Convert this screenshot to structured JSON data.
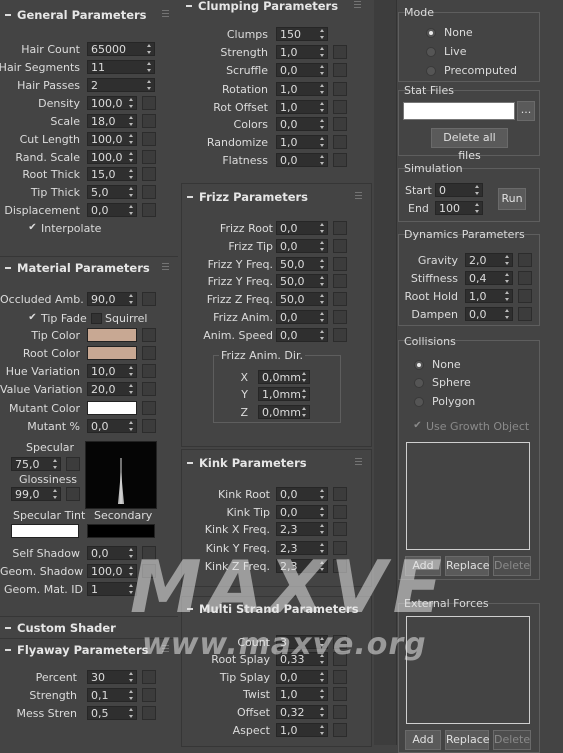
{
  "general": {
    "title": "General Parameters",
    "rows": [
      {
        "label": "Hair Count",
        "value": "65000"
      },
      {
        "label": "Hair Segments",
        "value": "11"
      },
      {
        "label": "Hair Passes",
        "value": "2"
      },
      {
        "label": "Density",
        "value": "100,0"
      },
      {
        "label": "Scale",
        "value": "18,0"
      },
      {
        "label": "Cut Length",
        "value": "100,0"
      },
      {
        "label": "Rand. Scale",
        "value": "100,0"
      },
      {
        "label": "Root Thick",
        "value": "15,0"
      },
      {
        "label": "Tip Thick",
        "value": "5,0"
      },
      {
        "label": "Displacement",
        "value": "0,0"
      }
    ],
    "interpolate": "Interpolate"
  },
  "material": {
    "title": "Material Parameters",
    "occluded_label": "Occluded Amb.",
    "occluded_value": "90,0",
    "tip_fade": "Tip Fade",
    "squirrel": "Squirrel",
    "tip_color_label": "Tip Color",
    "tip_color": "#c8a893",
    "root_color_label": "Root Color",
    "root_color": "#c8a893",
    "hue_label": "Hue Variation",
    "hue_value": "10,0",
    "value_label": "Value Variation",
    "value_value": "20,0",
    "mutant_color_label": "Mutant Color",
    "mutant_color": "#ffffff",
    "mutant_pct_label": "Mutant %",
    "mutant_pct_value": "0,0",
    "specular_label": "Specular",
    "specular_value": "75,0",
    "gloss_label": "Glossiness",
    "gloss_value": "99,0",
    "spec_tint_label": "Specular Tint",
    "spec_tint": "#ffffff",
    "secondary_label": "Secondary",
    "secondary": "#000000",
    "self_shadow_label": "Self Shadow",
    "self_shadow_value": "0,0",
    "geom_shadow_label": "Geom. Shadow",
    "geom_shadow_value": "100,0",
    "geom_mat_label": "Geom. Mat. ID",
    "geom_mat_value": "1"
  },
  "custom_shader": {
    "title": "Custom Shader"
  },
  "flyaway": {
    "title": "Flyaway Parameters",
    "rows": [
      {
        "label": "Percent",
        "value": "30"
      },
      {
        "label": "Strength",
        "value": "0,1"
      },
      {
        "label": "Mess Stren",
        "value": "0,5"
      }
    ]
  },
  "clumping": {
    "title": "Clumping Parameters",
    "rows": [
      {
        "label": "Clumps",
        "value": "150"
      },
      {
        "label": "Strength",
        "value": "1,0"
      },
      {
        "label": "Scruffle",
        "value": "0,0"
      },
      {
        "label": "Rotation",
        "value": "1,0"
      },
      {
        "label": "Rot Offset",
        "value": "1,0"
      },
      {
        "label": "Colors",
        "value": "0,0"
      },
      {
        "label": "Randomize",
        "value": "1,0"
      },
      {
        "label": "Flatness",
        "value": "0,0"
      }
    ]
  },
  "frizz": {
    "title": "Frizz Parameters",
    "rows": [
      {
        "label": "Frizz Root",
        "value": "0,0"
      },
      {
        "label": "Frizz Tip",
        "value": "0,0"
      },
      {
        "label": "Frizz Y Freq.",
        "value": "50,0"
      },
      {
        "label": "Frizz Y Freq.",
        "value": "50,0"
      },
      {
        "label": "Frizz Z Freq.",
        "value": "50,0"
      },
      {
        "label": "Frizz Anim.",
        "value": "0,0"
      },
      {
        "label": "Anim. Speed",
        "value": "0,0"
      }
    ],
    "anim_dir_label": "Frizz Anim. Dir.",
    "dir": [
      {
        "label": "X",
        "value": "0,0mm"
      },
      {
        "label": "Y",
        "value": "1,0mm"
      },
      {
        "label": "Z",
        "value": "0,0mm"
      }
    ]
  },
  "kink": {
    "title": "Kink Parameters",
    "rows": [
      {
        "label": "Kink Root",
        "value": "0,0"
      },
      {
        "label": "Kink Tip",
        "value": "0,0"
      },
      {
        "label": "Kink X Freq.",
        "value": "2,3"
      },
      {
        "label": "Kink Y Freq.",
        "value": "2,3"
      },
      {
        "label": "Kink Z Freq.",
        "value": "2,3"
      }
    ]
  },
  "multistrand": {
    "title": "Multi Strand Parameters",
    "rows": [
      {
        "label": "Count",
        "value": "3"
      },
      {
        "label": "Root Splay",
        "value": "0,33"
      },
      {
        "label": "Tip Splay",
        "value": "0,0"
      },
      {
        "label": "Twist",
        "value": "1,0"
      },
      {
        "label": "Offset",
        "value": "0,32"
      },
      {
        "label": "Aspect",
        "value": "1,0"
      }
    ]
  },
  "mode": {
    "title": "Mode",
    "options": [
      "None",
      "Live",
      "Precomputed"
    ],
    "selected": 0
  },
  "stat_files": {
    "title": "Stat Files",
    "browse": "...",
    "delete_all": "Delete all files"
  },
  "simulation": {
    "title": "Simulation",
    "start_label": "Start",
    "start_value": "0",
    "end_label": "End",
    "end_value": "100",
    "run": "Run"
  },
  "dynamics": {
    "title": "Dynamics Parameters",
    "rows": [
      {
        "label": "Gravity",
        "value": "2,0"
      },
      {
        "label": "Stiffness",
        "value": "0,4"
      },
      {
        "label": "Root Hold",
        "value": "1,0"
      },
      {
        "label": "Dampen",
        "value": "0,0"
      }
    ]
  },
  "collisions": {
    "title": "Collisions",
    "options": [
      "None",
      "Sphere",
      "Polygon"
    ],
    "selected": 0,
    "use_growth": "Use Growth Object",
    "add": "Add",
    "replace": "Replace",
    "delete": "Delete"
  },
  "external_forces": {
    "title": "External Forces",
    "add": "Add",
    "replace": "Replace",
    "delete": "Delete"
  },
  "watermark": {
    "big": "MAXVE",
    "small": "www.maxve.org"
  }
}
